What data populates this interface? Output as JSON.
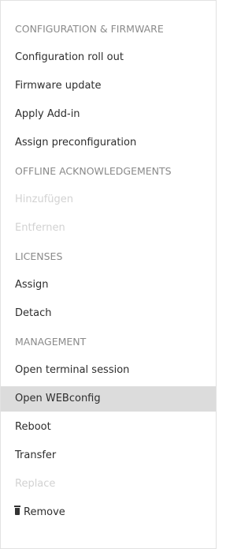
{
  "menu": {
    "sections": [
      {
        "header": "CONFIGURATION & FIRMWARE",
        "items": [
          {
            "label": "Configuration roll out",
            "disabled": false
          },
          {
            "label": "Firmware update",
            "disabled": false
          },
          {
            "label": "Apply Add-in",
            "disabled": false
          },
          {
            "label": "Assign preconfiguration",
            "disabled": false
          }
        ]
      },
      {
        "header": "OFFLINE ACKNOWLEDGEMENTS",
        "items": [
          {
            "label": "Hinzufügen",
            "disabled": true
          },
          {
            "label": "Entfernen",
            "disabled": true
          }
        ]
      },
      {
        "header": "LICENSES",
        "items": [
          {
            "label": "Assign",
            "disabled": false
          },
          {
            "label": "Detach",
            "disabled": false
          }
        ]
      },
      {
        "header": "MANAGEMENT",
        "items": [
          {
            "label": "Open terminal session",
            "disabled": false
          },
          {
            "label": "Open WEBconfig",
            "disabled": false,
            "highlighted": true
          },
          {
            "label": "Reboot",
            "disabled": false
          },
          {
            "label": "Transfer",
            "disabled": false
          },
          {
            "label": "Replace",
            "disabled": true
          },
          {
            "label": "Remove",
            "disabled": false,
            "icon": "trash-icon"
          }
        ]
      }
    ]
  },
  "colors": {
    "header_text": "#8a8a8a",
    "item_text": "#2e2e2e",
    "disabled_text": "#d2d2d2",
    "highlight_bg": "#dcdcdc",
    "border": "#e2e2e2"
  }
}
